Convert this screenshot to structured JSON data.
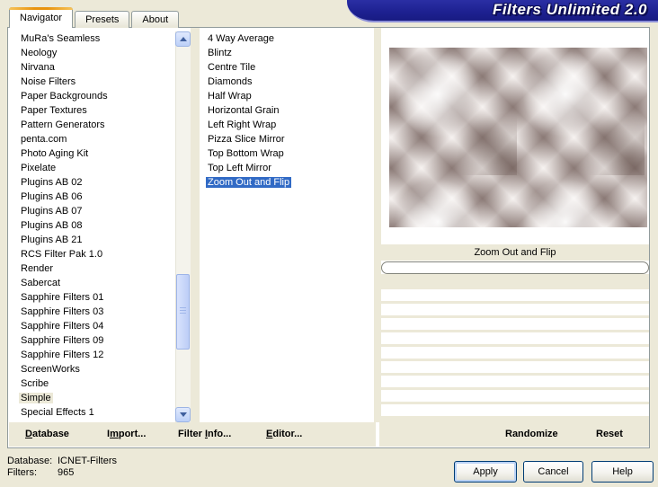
{
  "window": {
    "title": "Filters Unlimited 2.0"
  },
  "tabs": [
    {
      "label": "Navigator",
      "active": true
    },
    {
      "label": "Presets",
      "active": false
    },
    {
      "label": "About",
      "active": false
    }
  ],
  "category_list": {
    "items": [
      "MuRa's Seamless",
      "Neology",
      "Nirvana",
      "Noise Filters",
      "Paper Backgrounds",
      "Paper Textures",
      "Pattern Generators",
      "penta.com",
      "Photo Aging Kit",
      "Pixelate",
      "Plugins AB 02",
      "Plugins AB 06",
      "Plugins AB 07",
      "Plugins AB 08",
      "Plugins AB 21",
      "RCS Filter Pak 1.0",
      "Render",
      "Sabercat",
      "Sapphire Filters 01",
      "Sapphire Filters 03",
      "Sapphire Filters 04",
      "Sapphire Filters 09",
      "Sapphire Filters 12",
      "ScreenWorks",
      "Scribe",
      "Simple",
      "Special Effects 1"
    ],
    "selected": "Simple",
    "selected_index": 25
  },
  "filter_list": {
    "items": [
      "4 Way Average",
      "Blintz",
      "Centre Tile",
      "Diamonds",
      "Half Wrap",
      "Horizontal Grain",
      "Left Right Wrap",
      "Pizza Slice Mirror",
      "Top Bottom Wrap",
      "Top Left Mirror",
      "Zoom Out and Flip"
    ],
    "selected": "Zoom Out and Flip",
    "selected_index": 10
  },
  "preview": {
    "filter_name": "Zoom Out and Flip"
  },
  "toolbar": {
    "database": {
      "pre": "",
      "key": "D",
      "post": "atabase"
    },
    "import": {
      "pre": "I",
      "key": "m",
      "post": "port..."
    },
    "filter_info": {
      "pre": "Filter ",
      "key": "I",
      "post": "nfo..."
    },
    "editor": {
      "pre": "",
      "key": "E",
      "post": "ditor..."
    },
    "randomize": "Randomize",
    "reset": "Reset"
  },
  "status": {
    "database_label": "Database:",
    "database_value": "ICNET-Filters",
    "filters_label": "Filters:",
    "filters_value": "965"
  },
  "buttons": {
    "apply": "Apply",
    "cancel": "Cancel",
    "help": "Help"
  },
  "colors": {
    "dialog_bg": "#ece9d8",
    "banner": "#1d2090",
    "active_selection": "#316ac5",
    "inactive_selection": "#ece9d8",
    "tab_accent": "#e8930e",
    "panel_border": "#919b9c",
    "button_border": "#003c74"
  }
}
